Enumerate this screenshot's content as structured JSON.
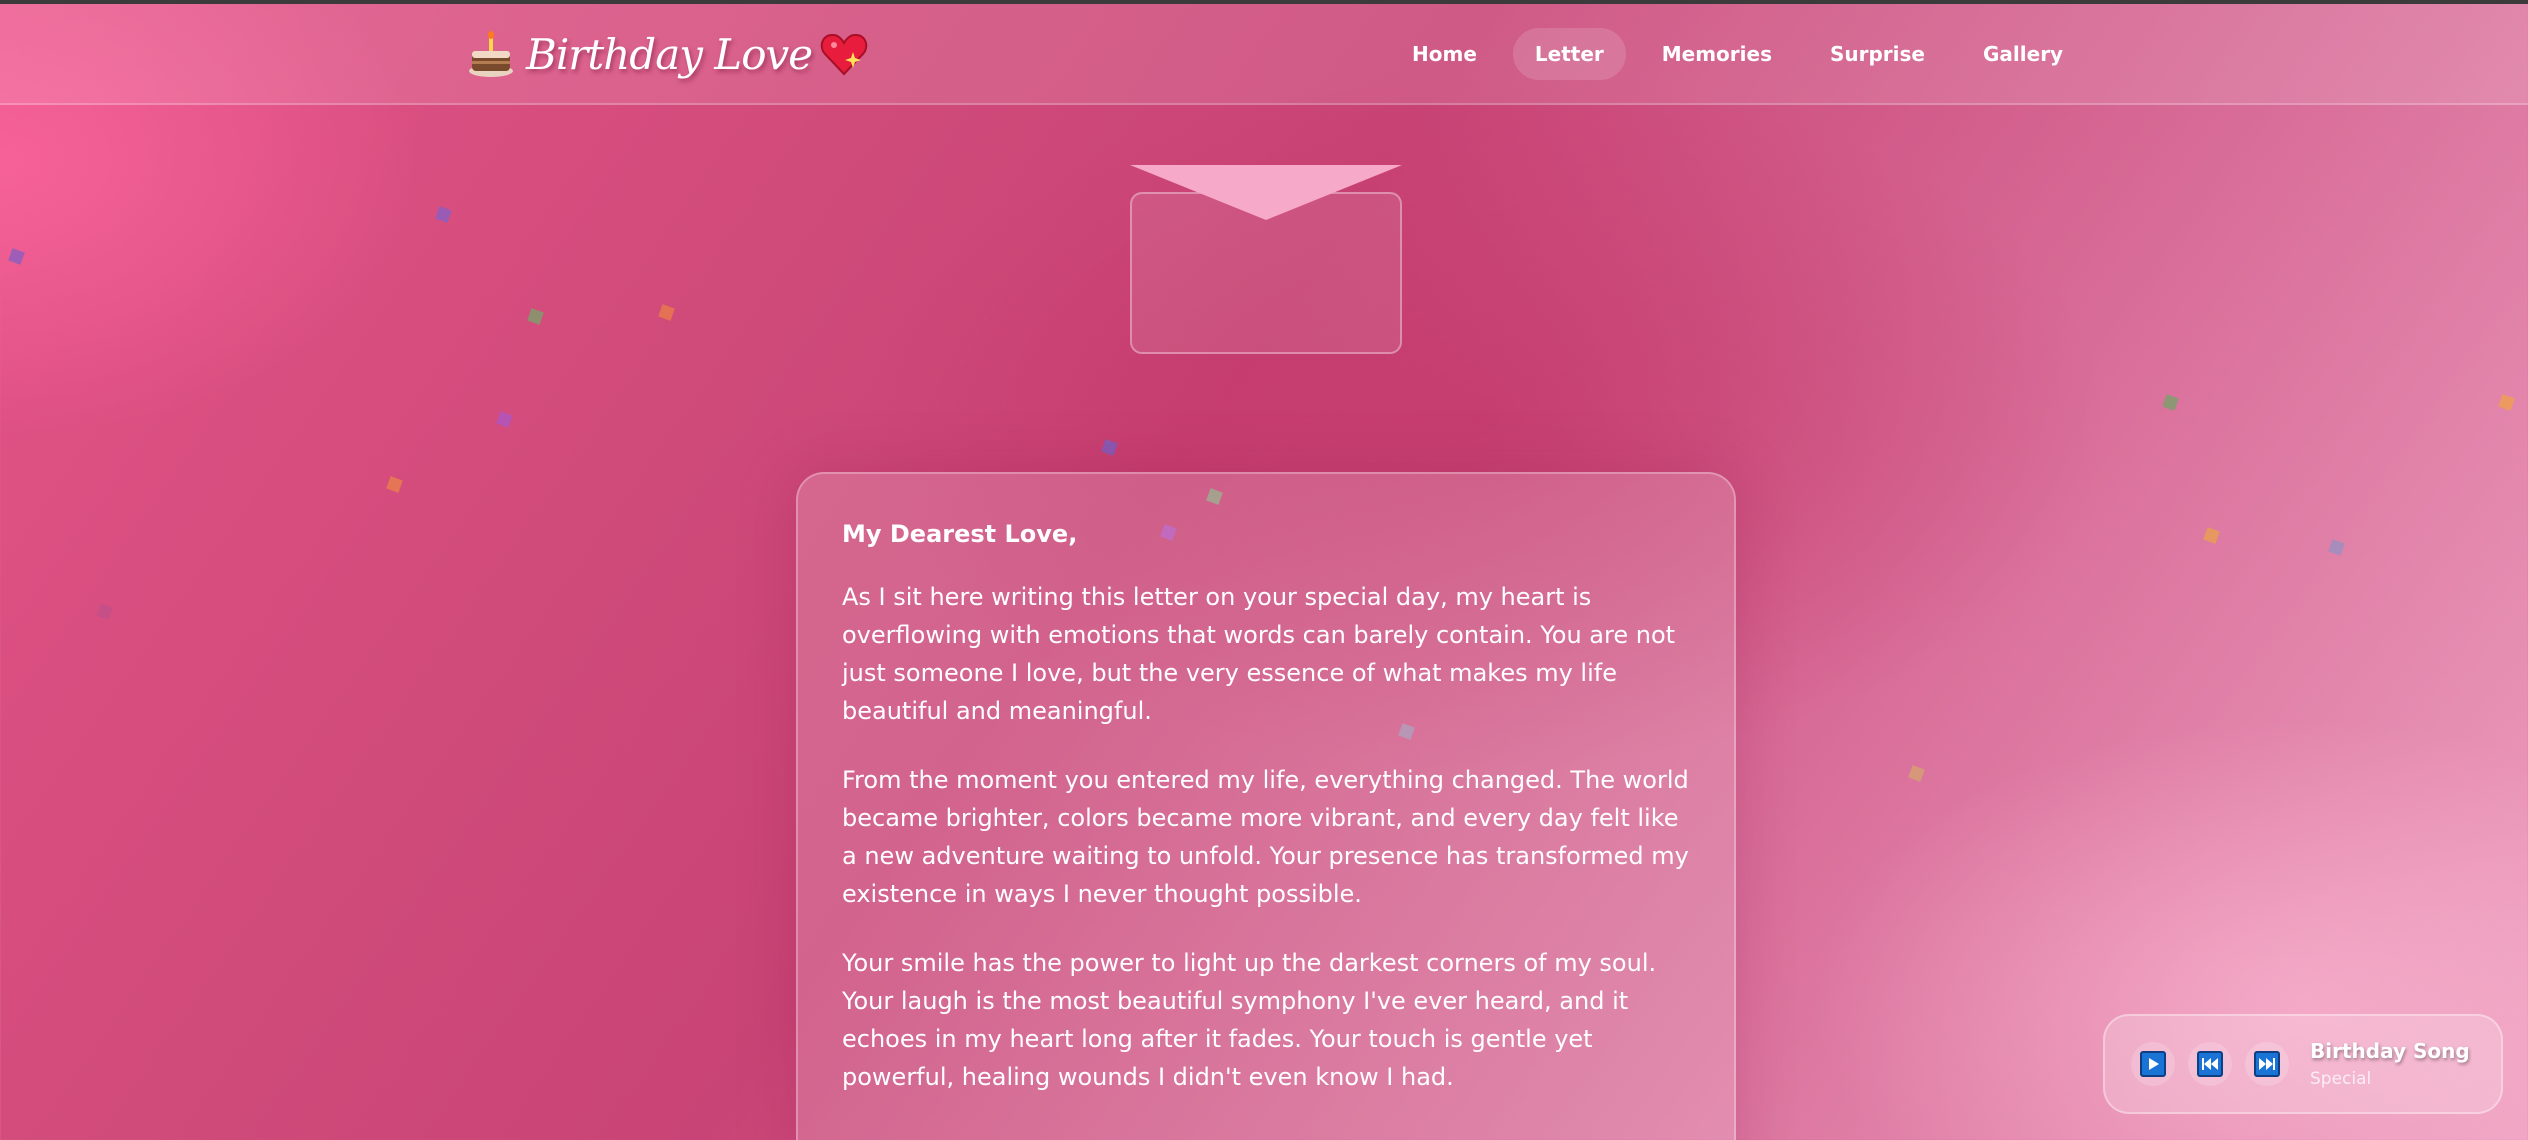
{
  "header": {
    "brand_title": "Birthday Love",
    "nav": [
      {
        "label": "Home"
      },
      {
        "label": "Letter",
        "active": true
      },
      {
        "label": "Memories"
      },
      {
        "label": "Surprise"
      },
      {
        "label": "Gallery"
      }
    ]
  },
  "letter": {
    "greeting": "My Dearest Love,",
    "paragraphs": [
      "As I sit here writing this letter on your special day, my heart is overflowing with emotions that words can barely contain. You are not just someone I love, but the very essence of what makes my life beautiful and meaningful.",
      "From the moment you entered my life, everything changed. The world became brighter, colors became more vibrant, and every day felt like a new adventure waiting to unfold. Your presence has transformed my existence in ways I never thought possible.",
      "Your smile has the power to light up the darkest corners of my soul. Your laugh is the most beautiful symphony I've ever heard, and it echoes in my heart long after it fades. Your touch is gentle yet powerful, healing wounds I didn't even know I had."
    ]
  },
  "player": {
    "track_title": "Birthday Song",
    "track_subtitle": "Special",
    "buttons": [
      "play-icon",
      "previous-icon",
      "next-icon"
    ]
  },
  "icons": {
    "brand_left": "cake-icon",
    "brand_right": "sparkling-heart-icon",
    "envelope": "envelope-icon"
  },
  "colors": {
    "accent_pink": "#e45387",
    "deep_rose": "#c94476",
    "light_pink": "#eea1c1",
    "player_button_blue": "#1a74d6"
  }
}
